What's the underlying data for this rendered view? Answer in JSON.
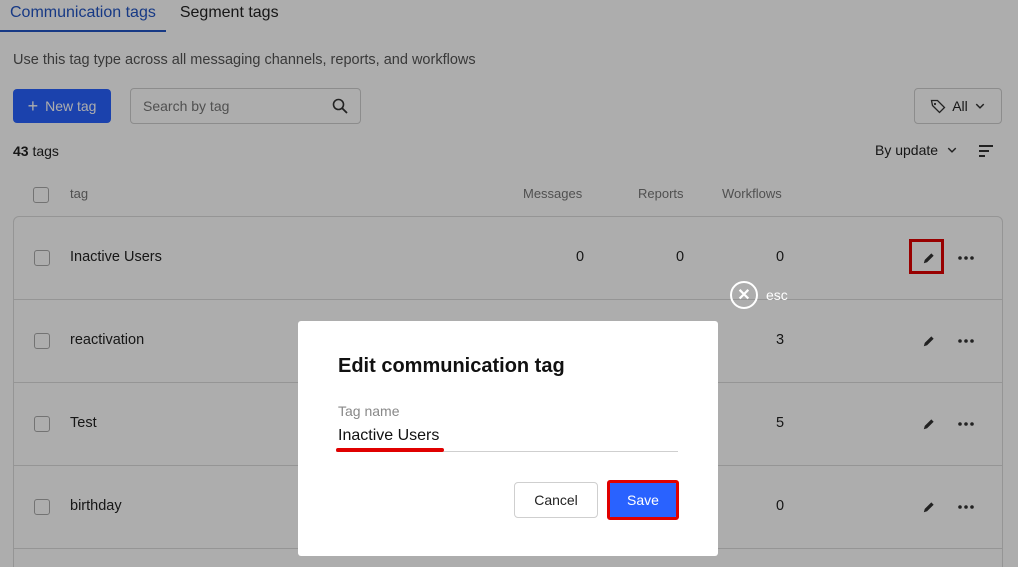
{
  "tabs": [
    {
      "label": "Communication tags",
      "active": true
    },
    {
      "label": "Segment tags",
      "active": false
    }
  ],
  "description": "Use this tag type across all messaging channels, reports, and workflows",
  "toolbar": {
    "new_tag_label": "New tag",
    "search_placeholder": "Search by tag",
    "filter_label": "All"
  },
  "count": {
    "number": "43",
    "suffix": "tags"
  },
  "sort": {
    "label": "By update"
  },
  "columns": {
    "tag": "tag",
    "messages": "Messages",
    "reports": "Reports",
    "workflows": "Workflows"
  },
  "rows": [
    {
      "name": "Inactive Users",
      "messages": "0",
      "reports": "0",
      "workflows": "0"
    },
    {
      "name": "reactivation",
      "messages": "",
      "reports": "",
      "workflows": "3"
    },
    {
      "name": "Test",
      "messages": "",
      "reports": "",
      "workflows": "5"
    },
    {
      "name": "birthday",
      "messages": "",
      "reports": "",
      "workflows": "0"
    }
  ],
  "esc_label": "esc",
  "modal": {
    "title": "Edit communication tag",
    "field_label": "Tag name",
    "field_value": "Inactive Users",
    "cancel_label": "Cancel",
    "save_label": "Save"
  },
  "colors": {
    "accent": "#2962ff",
    "highlight": "#e00000"
  }
}
